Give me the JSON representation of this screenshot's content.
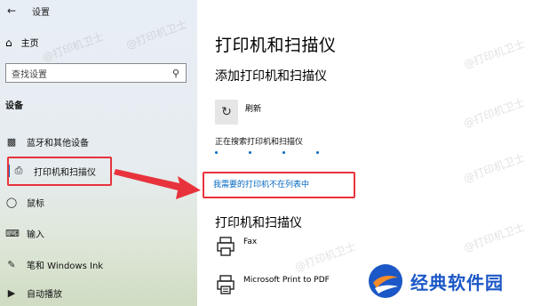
{
  "sidebar": {
    "back_icon": "arrow-left-icon",
    "title": "设置",
    "home_label": "主页",
    "search_placeholder": "查找设置",
    "section_label": "设备",
    "items": [
      {
        "label": "蓝牙和其他设备",
        "icon": "bluetooth-devices-icon"
      },
      {
        "label": "打印机和扫描仪",
        "icon": "printer-icon",
        "active": true
      },
      {
        "label": "鼠标",
        "icon": "mouse-icon"
      },
      {
        "label": "输入",
        "icon": "keyboard-icon"
      },
      {
        "label": "笔和 Windows Ink",
        "icon": "pen-icon"
      },
      {
        "label": "自动播放",
        "icon": "autoplay-icon"
      }
    ]
  },
  "main": {
    "title": "打印机和扫描仪",
    "add_heading": "添加打印机和扫描仪",
    "refresh_label": "刷新",
    "searching_text": "正在搜索打印机和扫描仪",
    "not_listed_link": "我需要的打印机不在列表中",
    "list_heading": "打印机和扫描仪",
    "printers": [
      {
        "name": "Fax",
        "icon": "fax-printer-icon"
      },
      {
        "name": "Microsoft Print to PDF",
        "icon": "pdf-printer-icon"
      }
    ]
  },
  "watermark": "@打印机卫士",
  "logo_text": "经典软件园",
  "colors": {
    "accent": "#0067c0",
    "highlight": "#e8333c",
    "logo": "#1b57c6"
  }
}
